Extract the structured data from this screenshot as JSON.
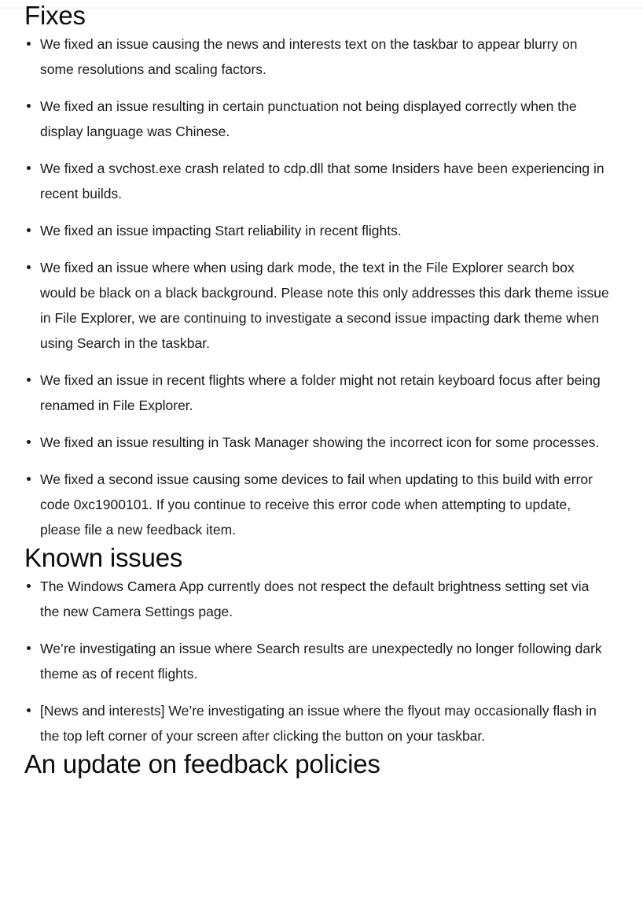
{
  "page": {
    "background_color": "#ffffff",
    "text_color": "#1b1b1b",
    "heading_color": "#0d0d0d"
  },
  "sections": [
    {
      "id": "fixes",
      "heading": "Fixes",
      "items": [
        "We fixed an issue causing the news and interests text on the taskbar to appear blurry on some resolutions and scaling factors.",
        "We fixed an issue resulting in certain punctuation not being displayed correctly when the display language was Chinese.",
        "We fixed a svchost.exe crash related to cdp.dll that some Insiders have been experiencing in recent builds.",
        "We fixed an issue impacting Start reliability in recent flights.",
        "We fixed an issue where when using dark mode, the text in the File Explorer search box would be black on a black background. Please note this only addresses this dark theme issue in File Explorer, we are continuing to investigate a second issue impacting dark theme when using Search in the taskbar.",
        "We fixed an issue in recent flights where a folder might not retain keyboard focus after being renamed in File Explorer.",
        "We fixed an issue resulting in Task Manager showing the incorrect icon for some processes.",
        "We fixed a second issue causing some devices to fail when updating to this build with error code 0xc1900101. If you continue to receive this error code when attempting to update, please file a new feedback item."
      ]
    },
    {
      "id": "known-issues",
      "heading": "Known issues",
      "items": [
        "The Windows Camera App currently does not respect the default brightness setting set via the new Camera Settings page.",
        "We’re investigating an issue where Search results are unexpectedly no longer following dark theme as of recent flights.",
        "[News and interests] We’re investigating an issue where the flyout may occasionally flash in the top left corner of your screen after clicking the button on your taskbar."
      ]
    },
    {
      "id": "feedback-policies",
      "heading": "An update on feedback policies",
      "items": []
    }
  ]
}
